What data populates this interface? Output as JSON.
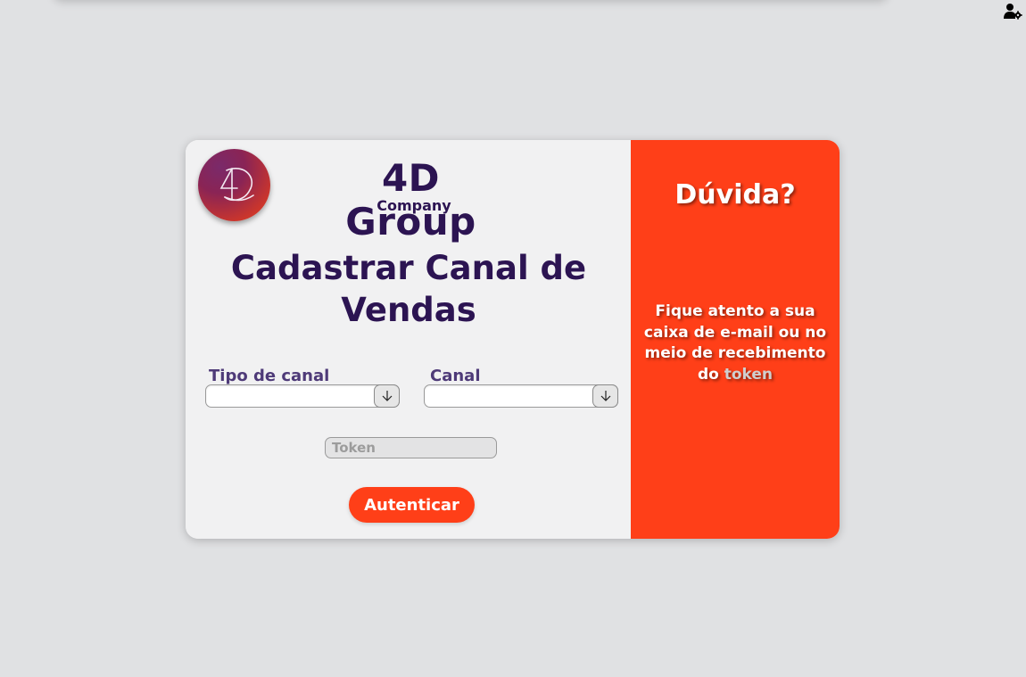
{
  "header": {
    "user_settings_icon": "user-gear-icon"
  },
  "brand": {
    "name": "4D Group",
    "subtitle": "Company",
    "logo_text": "4D",
    "logo_icon": "4d-logo-icon"
  },
  "form": {
    "title": "Cadastrar Canal de Vendas",
    "tipo_canal_label": "Tipo de canal",
    "tipo_canal_value": "",
    "canal_label": "Canal",
    "canal_value": "",
    "dropdown_icon": "arrow-down-icon",
    "token_placeholder": "Token",
    "token_value": "",
    "submit_label": "Autenticar"
  },
  "help": {
    "title": "Dúvida?",
    "text": "Fique atento a sua caixa de e-mail ou no meio de recebimento do",
    "highlight": "token"
  },
  "colors": {
    "accent": "#ff3f18",
    "brand_dark": "#2c1452",
    "background": "#e0e1e3",
    "card": "#f1f1f2"
  }
}
